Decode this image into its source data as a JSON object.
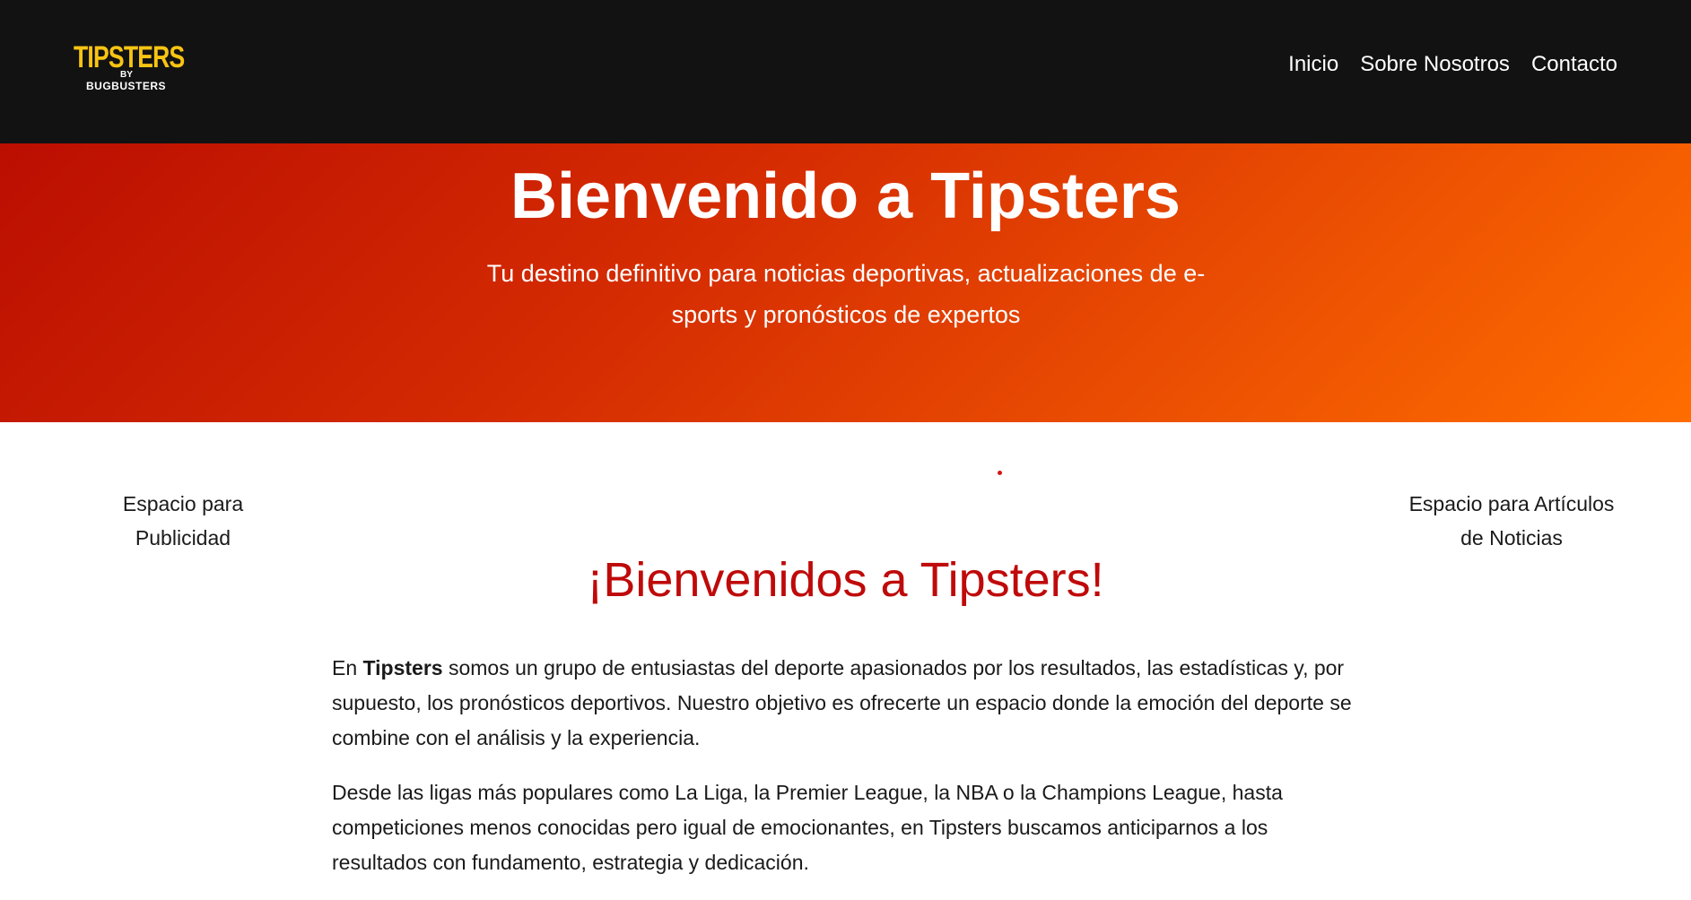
{
  "header": {
    "logo": {
      "main": "TIPSTERS",
      "by": "BY",
      "sub": "BUGBUSTERS"
    },
    "nav": [
      {
        "label": "Inicio"
      },
      {
        "label": "Sobre Nosotros"
      },
      {
        "label": "Contacto"
      }
    ]
  },
  "hero": {
    "title": "Bienvenido a Tipsters",
    "subtitle": "Tu destino definitivo para noticias deportivas, actualizaciones de e-sports y pronósticos de expertos"
  },
  "sidebar_left": {
    "text": "Espacio para Publicidad"
  },
  "sidebar_right": {
    "text": "Espacio para Artículos de Noticias"
  },
  "main": {
    "title": "¡Bienvenidos a Tipsters!",
    "paragraph1": {
      "prefix": "En ",
      "bold": "Tipsters",
      "rest": " somos un grupo de entusiastas del deporte apasionados por los resultados, las estadísticas y, por supuesto, los pronósticos deportivos. Nuestro objetivo es ofrecerte un espacio donde la emoción del deporte se combine con el análisis y la experiencia."
    },
    "paragraph2": "Desde las ligas más populares como La Liga, la Premier League, la NBA o la Champions League, hasta competiciones menos conocidas pero igual de emocionantes, en Tipsters buscamos anticiparnos a los resultados con fundamento, estrategia y dedicación."
  },
  "colors": {
    "header_bg": "#121212",
    "logo_yellow": "#f8c413",
    "hero_gradient_start": "#bb0e02",
    "hero_gradient_end": "#ff6d00",
    "welcome_red": "#bf0a0a"
  }
}
